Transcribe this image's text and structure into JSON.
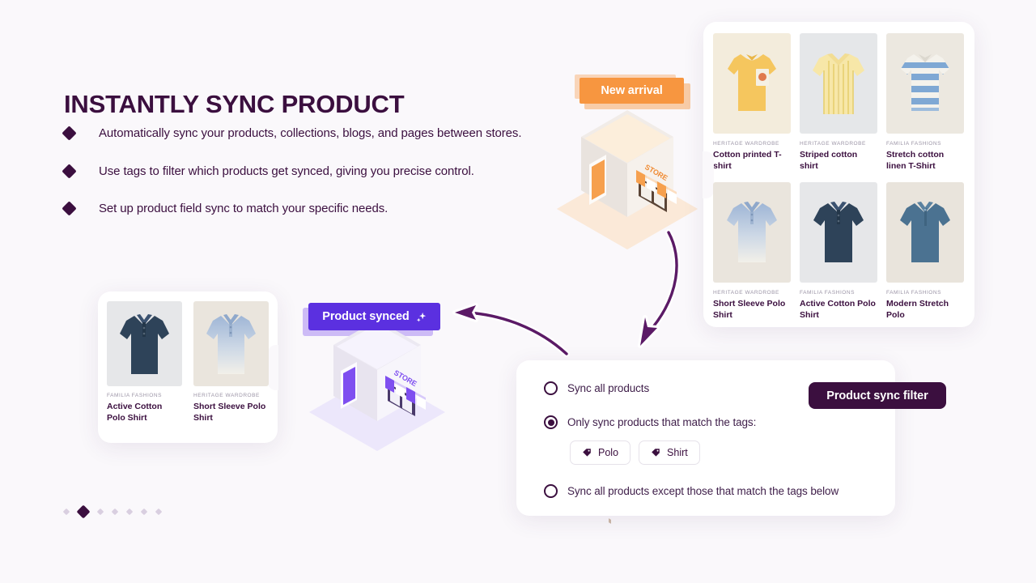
{
  "headline": "INSTANTLY SYNC PRODUCT",
  "bullets": [
    "Automatically sync your products, collections, blogs, and pages between stores.",
    "Use tags to filter which products get synced, giving you precise control.",
    "Set up product field sync to match your specific needs."
  ],
  "badges": {
    "new_arrival": "New arrival",
    "product_synced": "Product synced",
    "sync_filter": "Product sync filter"
  },
  "product_grid": {
    "items": [
      {
        "vendor": "HERITAGE WARDROBE",
        "name": "Cotton printed T-shirt"
      },
      {
        "vendor": "HERITAGE WARDROBE",
        "name": "Striped cotton shirt"
      },
      {
        "vendor": "FAMILIA FASHIONS",
        "name": "Stretch cotton linen T-Shirt"
      },
      {
        "vendor": "HERITAGE WARDROBE",
        "name": "Short Sleeve Polo Shirt"
      },
      {
        "vendor": "FAMILIA FASHIONS",
        "name": "Active Cotton Polo Shirt"
      },
      {
        "vendor": "FAMILIA FASHIONS",
        "name": "Modern Stretch Polo"
      }
    ]
  },
  "synced_products": {
    "items": [
      {
        "vendor": "FAMILIA FASHIONS",
        "name": "Active Cotton Polo Shirt"
      },
      {
        "vendor": "HERITAGE WARDROBE",
        "name": "Short Sleeve Polo Shirt"
      }
    ]
  },
  "filter_panel": {
    "options": [
      {
        "label": "Sync all products",
        "selected": false
      },
      {
        "label": "Only sync products that match the tags:",
        "selected": true
      },
      {
        "label": "Sync all products except those that match the tags below",
        "selected": false
      }
    ],
    "tags": [
      "Polo",
      "Shirt"
    ]
  },
  "stores": {
    "source_sign": "STORE",
    "target_sign": "STORE"
  },
  "carousel": {
    "total_dots": 7,
    "active_index": 1
  },
  "colors": {
    "background": "#faf8fb",
    "brand_dark": "#3b0f3f",
    "accent_orange": "#f79640",
    "accent_purple": "#5b30e0",
    "muted_text": "#9b94a6"
  }
}
